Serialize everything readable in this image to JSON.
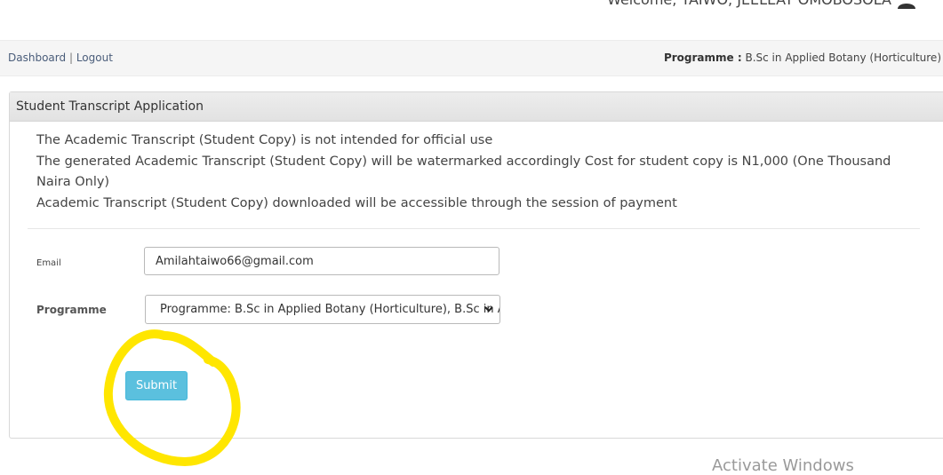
{
  "header": {
    "welcome_text": "Welcome, TAIWO, JEELEAT OMOBOSOLA"
  },
  "nav": {
    "dashboard": "Dashboard",
    "separator": "|",
    "logout": "Logout"
  },
  "programme_info": {
    "label": "Programme :",
    "value": "B.Sc in Applied Botany (Horticulture)"
  },
  "panel": {
    "title": "Student Transcript Application",
    "notes": [
      "The Academic Transcript (Student Copy) is not intended for official use",
      "The generated Academic Transcript (Student Copy) will be watermarked accordingly Cost for student copy is N1,000 (One Thousand Naira Only)",
      "Academic Transcript (Student Copy) downloaded will be accessible through the session of payment"
    ]
  },
  "form": {
    "email_label": "Email",
    "email_value": "Amilahtaiwo66@gmail.com",
    "programme_label": "Programme",
    "programme_value": "Programme: B.Sc in Applied Botany (Horticulture), B.Sc in Applied Botany (Horticulture)",
    "submit_label": "Submit"
  },
  "annotation_color": "#ffe600",
  "os_watermark": "Activate Windows"
}
